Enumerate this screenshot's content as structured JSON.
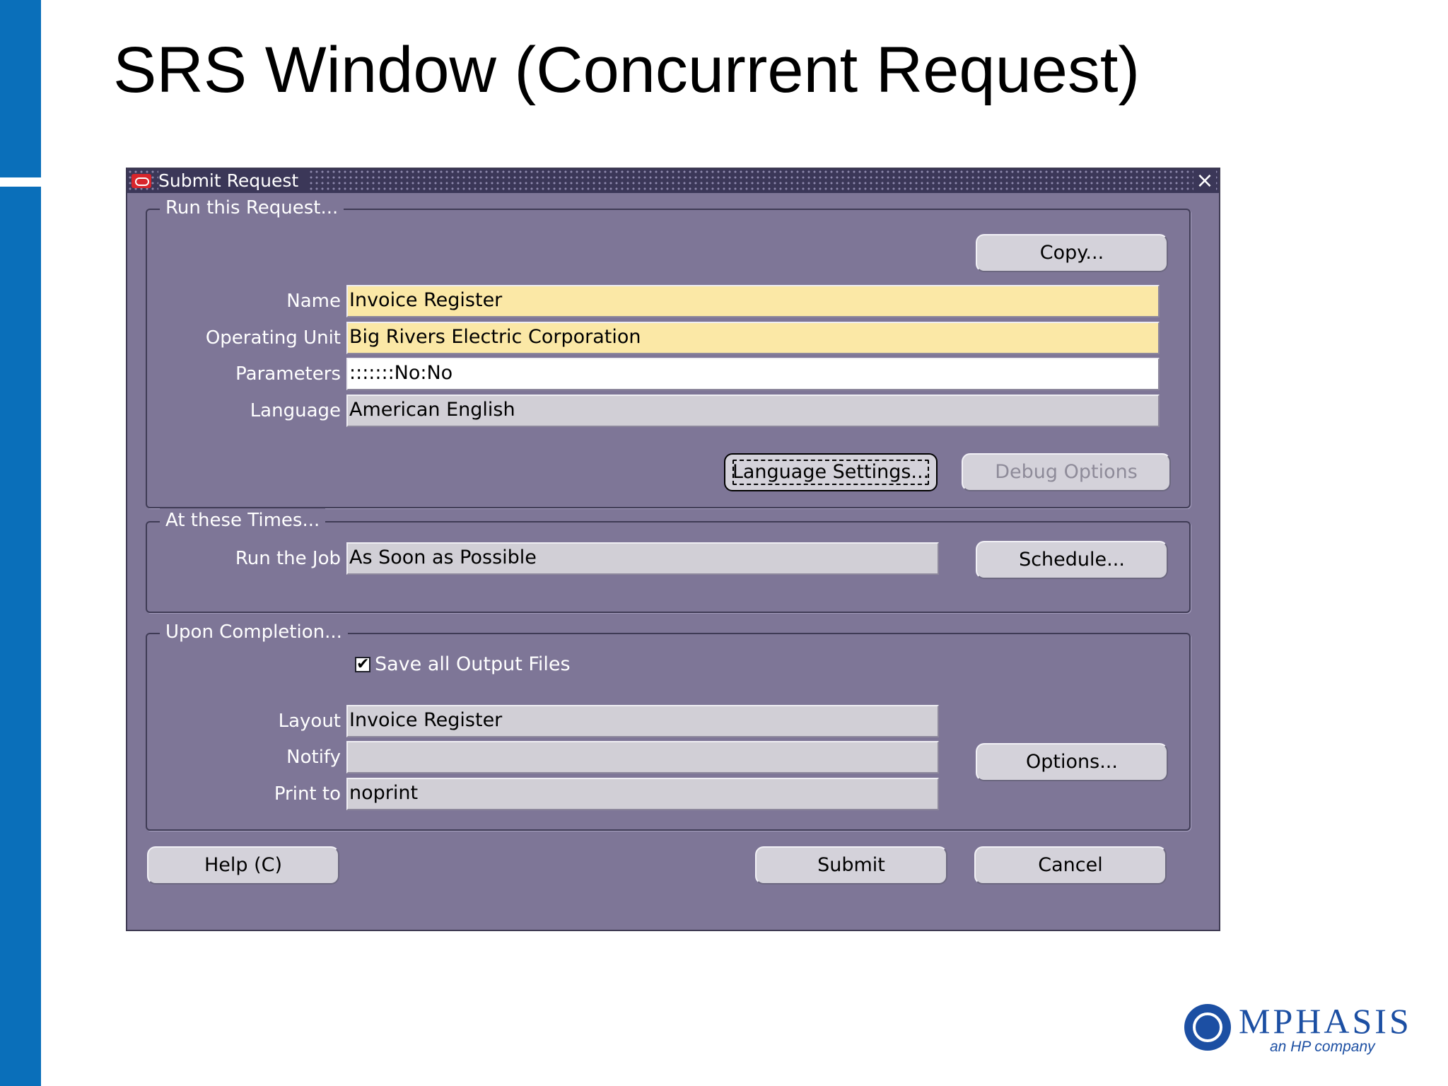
{
  "slide": {
    "title": "SRS Window (Concurrent Request)",
    "logo": {
      "name": "MPHASIS",
      "tagline": "an HP company",
      "color": "#1c4fa3"
    },
    "accent_color": "#0a6fba"
  },
  "window": {
    "title": "Submit Request",
    "close_icon": "×",
    "background_color": "#7e7697",
    "run_section": {
      "legend": "Run this Request...",
      "copy_button": "Copy...",
      "fields": {
        "name": {
          "label": "Name",
          "value": "Invoice Register"
        },
        "operating_unit": {
          "label": "Operating Unit",
          "value": "Big Rivers Electric Corporation"
        },
        "parameters": {
          "label": "Parameters",
          "value": ":::::::No:No"
        },
        "language": {
          "label": "Language",
          "value": "American English"
        }
      },
      "language_settings_button": "Language Settings...",
      "debug_options_button": "Debug Options"
    },
    "times_section": {
      "legend": "At these Times...",
      "run_job": {
        "label": "Run the Job",
        "value": "As Soon as Possible"
      },
      "schedule_button": "Schedule..."
    },
    "completion_section": {
      "legend": "Upon Completion...",
      "save_output": {
        "label": "Save all Output Files",
        "checked": true,
        "mark": "✔"
      },
      "layout": {
        "label": "Layout",
        "value": "Invoice Register"
      },
      "notify": {
        "label": "Notify",
        "value": ""
      },
      "print_to": {
        "label": "Print to",
        "value": "noprint"
      },
      "options_button": "Options..."
    },
    "footer": {
      "help_button": "Help (C)",
      "submit_button": "Submit",
      "cancel_button": "Cancel"
    },
    "colors": {
      "required_field": "#fbe8a6",
      "editable_field": "#ffffff",
      "readonly_field": "#d1cfd6",
      "button": "#d4d2da"
    }
  }
}
